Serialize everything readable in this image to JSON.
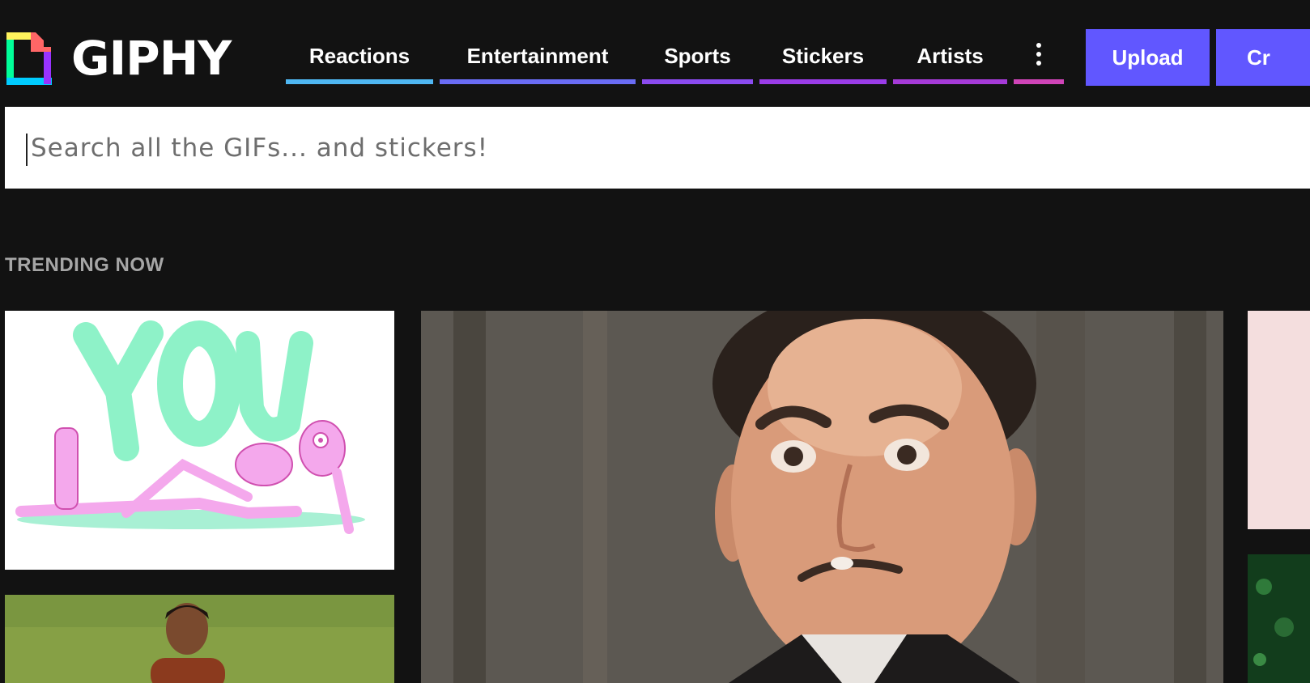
{
  "brand": {
    "name": "GIPHY"
  },
  "nav": {
    "items": [
      {
        "label": "Reactions",
        "color": "#4fb7f2"
      },
      {
        "label": "Entertainment",
        "color": "#6a6cf5"
      },
      {
        "label": "Sports",
        "color": "#8b4bf0"
      },
      {
        "label": "Stickers",
        "color": "#9a3ce8"
      },
      {
        "label": "Artists",
        "color": "#a53ad8"
      }
    ],
    "more_color": "#d044b8"
  },
  "actions": {
    "upload_label": "Upload",
    "create_label": "Cr"
  },
  "search": {
    "placeholder": "Search all the GIFs... and stickers!",
    "value": ""
  },
  "trending": {
    "title": "TRENDING NOW"
  },
  "colors": {
    "accent": "#6157ff",
    "background": "#121212"
  }
}
